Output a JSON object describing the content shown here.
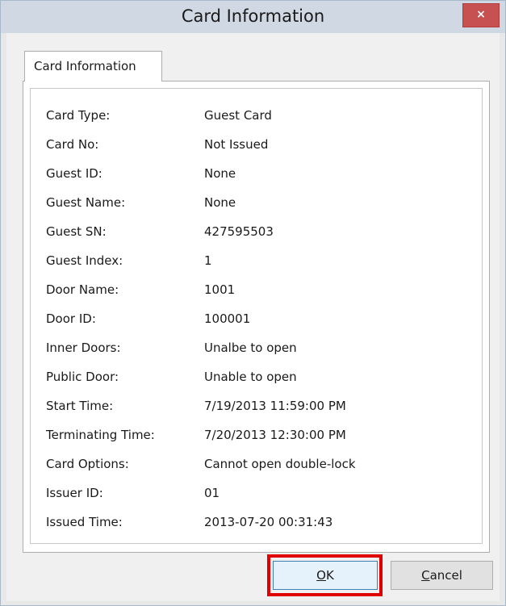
{
  "window": {
    "title": "Card Information",
    "close_symbol": "×"
  },
  "tab": {
    "label": "Card Information"
  },
  "fields": [
    {
      "label": "Card Type:",
      "value": "Guest Card"
    },
    {
      "label": "Card No:",
      "value": "Not Issued"
    },
    {
      "label": "Guest ID:",
      "value": "None"
    },
    {
      "label": "Guest Name:",
      "value": "None"
    },
    {
      "label": "Guest SN:",
      "value": "427595503"
    },
    {
      "label": "Guest Index:",
      "value": "1"
    },
    {
      "label": "Door Name:",
      "value": "1001"
    },
    {
      "label": "Door ID:",
      "value": "100001"
    },
    {
      "label": "Inner Doors:",
      "value": "Unalbe to open"
    },
    {
      "label": "Public Door:",
      "value": "Unable to open"
    },
    {
      "label": "Start Time:",
      "value": "7/19/2013 11:59:00 PM"
    },
    {
      "label": "Terminating Time:",
      "value": "7/20/2013 12:30:00 PM"
    },
    {
      "label": "Card Options:",
      "value": "Cannot open double-lock"
    },
    {
      "label": "Issuer ID:",
      "value": "01"
    },
    {
      "label": "Issued Time:",
      "value": "2013-07-20 00:31:43"
    }
  ],
  "buttons": {
    "ok_mnemonic": "O",
    "ok_rest": "K",
    "cancel_mnemonic": "C",
    "cancel_rest": "ancel"
  },
  "colors": {
    "highlight": "#e00000",
    "close_button": "#c75050",
    "titlebar": "#cfd8e3"
  }
}
